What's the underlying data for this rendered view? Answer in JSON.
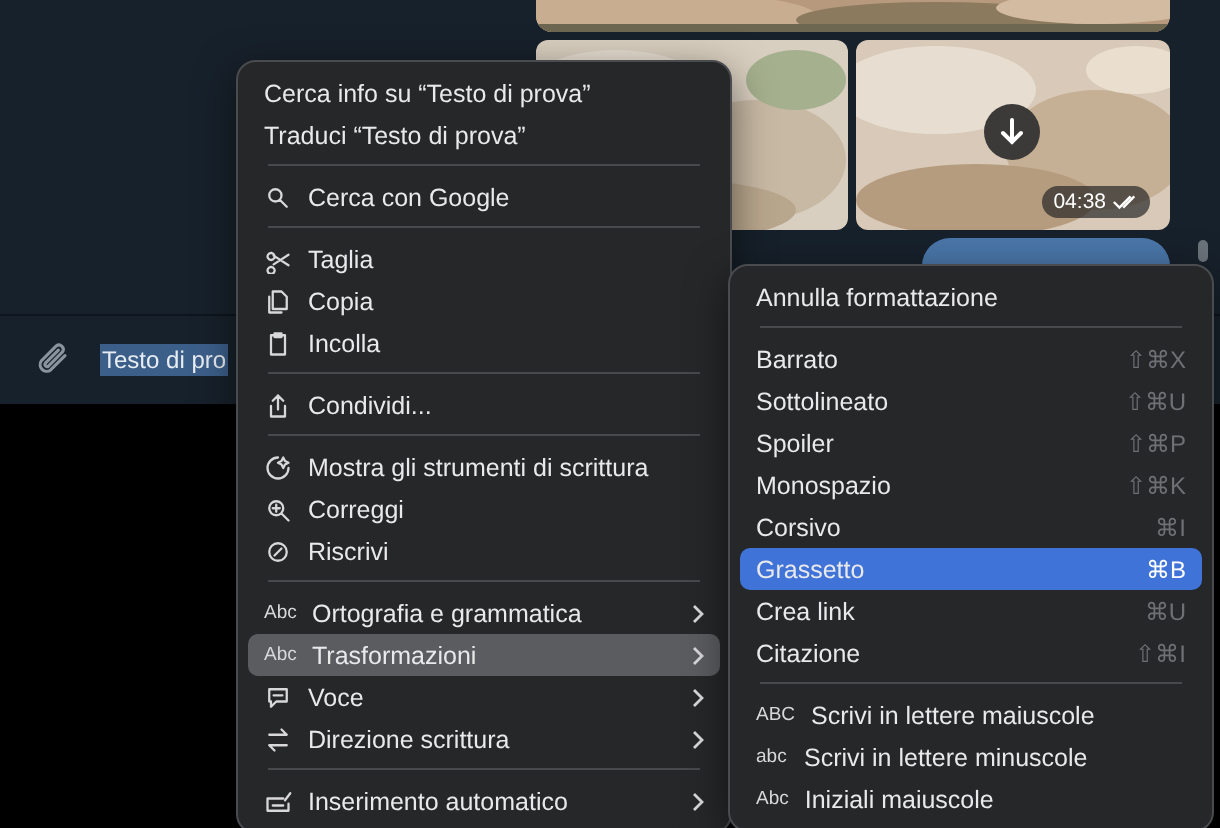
{
  "media": {
    "time": "04:38"
  },
  "composer": {
    "text": "Testo di pro"
  },
  "context_menu": {
    "sections": [
      [
        {
          "kind": "text",
          "label": "Cerca info su “Testo di prova”",
          "has_submenu": false,
          "selected": false
        },
        {
          "kind": "text",
          "label": "Traduci “Testo di prova”",
          "has_submenu": false,
          "selected": false
        }
      ],
      [
        {
          "kind": "icon",
          "label": "Cerca con Google",
          "has_submenu": false,
          "selected": false
        }
      ],
      [
        {
          "kind": "icon",
          "label": "Taglia",
          "has_submenu": false,
          "selected": false
        },
        {
          "kind": "icon",
          "label": "Copia",
          "has_submenu": false,
          "selected": false
        },
        {
          "kind": "icon",
          "label": "Incolla",
          "has_submenu": false,
          "selected": false
        }
      ],
      [
        {
          "kind": "icon",
          "label": "Condividi...",
          "has_submenu": false,
          "selected": false
        }
      ],
      [
        {
          "kind": "icon",
          "label": "Mostra gli strumenti di scrittura",
          "has_submenu": false,
          "selected": false
        },
        {
          "kind": "icon",
          "label": "Correggi",
          "has_submenu": false,
          "selected": false
        },
        {
          "kind": "icon",
          "label": "Riscrivi",
          "has_submenu": false,
          "selected": false
        }
      ],
      [
        {
          "kind": "tag",
          "tag": "Abc",
          "label": "Ortografia e grammatica",
          "has_submenu": true,
          "selected": false
        },
        {
          "kind": "tag",
          "tag": "Abc",
          "label": "Trasformazioni",
          "has_submenu": true,
          "selected": true
        },
        {
          "kind": "icon",
          "label": "Voce",
          "has_submenu": true,
          "selected": false
        },
        {
          "kind": "icon",
          "label": "Direzione scrittura",
          "has_submenu": true,
          "selected": false
        }
      ],
      [
        {
          "kind": "icon",
          "label": "Inserimento automatico",
          "has_submenu": true,
          "selected": false
        }
      ]
    ]
  },
  "submenu": {
    "sections": [
      [
        {
          "kind": "text",
          "label": "Annulla formattazione",
          "selected": false
        }
      ],
      [
        {
          "kind": "text",
          "label": "Barrato",
          "shortcut": "⇧⌘X",
          "selected": false
        },
        {
          "kind": "text",
          "label": "Sottolineato",
          "shortcut": "⇧⌘U",
          "selected": false
        },
        {
          "kind": "text",
          "label": "Spoiler",
          "shortcut": "⇧⌘P",
          "selected": false
        },
        {
          "kind": "text",
          "label": "Monospazio",
          "shortcut": "⇧⌘K",
          "selected": false
        },
        {
          "kind": "text",
          "label": "Corsivo",
          "shortcut": "⌘I",
          "selected": false
        },
        {
          "kind": "text",
          "label": "Grassetto",
          "shortcut": "⌘B",
          "selected": true
        },
        {
          "kind": "text",
          "label": "Crea link",
          "shortcut": "⌘U",
          "selected": false
        },
        {
          "kind": "text",
          "label": "Citazione",
          "shortcut": "⇧⌘I",
          "selected": false
        }
      ],
      [
        {
          "kind": "tag",
          "tag": "ABC",
          "label": "Scrivi in lettere maiuscole",
          "selected": false
        },
        {
          "kind": "tag",
          "tag": "abc",
          "label": "Scrivi in lettere minuscole",
          "selected": false
        },
        {
          "kind": "tag",
          "tag": "Abc",
          "label": "Iniziali maiuscole",
          "selected": false
        }
      ]
    ]
  }
}
